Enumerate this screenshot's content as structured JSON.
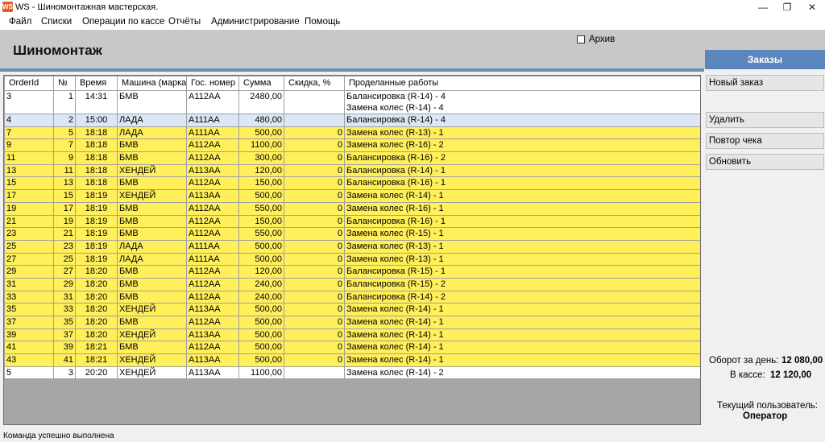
{
  "window": {
    "title": "WS - Шиномонтажная мастерская.",
    "app_icon": "WS",
    "minimize_glyph": "—",
    "restore_glyph": "❐",
    "close_glyph": "✕"
  },
  "menu": [
    "Файл",
    "Списки",
    "Операции по кассе",
    "Отчёты",
    "Администрирование",
    "Помощь"
  ],
  "page": {
    "title": "Шиномонтаж",
    "archive_label": "Архив"
  },
  "sidebar": {
    "tab": "Заказы",
    "new_order": "Новый заказ",
    "delete": "Удалить",
    "repeat_receipt": "Повтор чека",
    "refresh": "Обновить"
  },
  "table": {
    "columns": [
      "OrderId",
      "№",
      "Время",
      "Машина (марка)",
      "Гос. номер",
      "Сумма",
      "Скидка, %",
      "Проделанные работы"
    ],
    "rows": [
      {
        "style": "white",
        "cells": [
          "3",
          "1",
          "14:31",
          "БМВ",
          "А112АА",
          "2480,00",
          "",
          "Балансировка (R-14) - 4",
          "Замена колес (R-14) - 4"
        ]
      },
      {
        "style": "sel",
        "cells": [
          "4",
          "2",
          "15:00",
          "ЛАДА",
          "А111АА",
          "480,00",
          "",
          "Балансировка (R-14) - 4"
        ]
      },
      {
        "style": "yellow",
        "cells": [
          "7",
          "5",
          "18:18",
          "ЛАДА",
          "А111АА",
          "500,00",
          "0",
          "Замена колес (R-13) - 1"
        ]
      },
      {
        "style": "yellow",
        "cells": [
          "9",
          "7",
          "18:18",
          "БМВ",
          "А112АА",
          "1100,00",
          "0",
          "Замена колес (R-16) - 2"
        ]
      },
      {
        "style": "yellow",
        "cells": [
          "11",
          "9",
          "18:18",
          "БМВ",
          "А112АА",
          "300,00",
          "0",
          "Балансировка (R-16) - 2"
        ]
      },
      {
        "style": "yellow",
        "cells": [
          "13",
          "11",
          "18:18",
          "ХЕНДЕЙ",
          "А113АА",
          "120,00",
          "0",
          "Балансировка (R-14) - 1"
        ]
      },
      {
        "style": "yellow",
        "cells": [
          "15",
          "13",
          "18:18",
          "БМВ",
          "А112АА",
          "150,00",
          "0",
          "Балансировка (R-16) - 1"
        ]
      },
      {
        "style": "yellow",
        "cells": [
          "17",
          "15",
          "18:19",
          "ХЕНДЕЙ",
          "А113АА",
          "500,00",
          "0",
          "Замена колес (R-14) - 1"
        ]
      },
      {
        "style": "yellow",
        "cells": [
          "19",
          "17",
          "18:19",
          "БМВ",
          "А112АА",
          "550,00",
          "0",
          "Замена колес (R-16) - 1"
        ]
      },
      {
        "style": "yellow",
        "cells": [
          "21",
          "19",
          "18:19",
          "БМВ",
          "А112АА",
          "150,00",
          "0",
          "Балансировка (R-16) - 1"
        ]
      },
      {
        "style": "yellow",
        "cells": [
          "23",
          "21",
          "18:19",
          "БМВ",
          "А112АА",
          "550,00",
          "0",
          "Замена колес (R-15) - 1"
        ]
      },
      {
        "style": "yellow",
        "cells": [
          "25",
          "23",
          "18:19",
          "ЛАДА",
          "А111АА",
          "500,00",
          "0",
          "Замена колес (R-13) - 1"
        ]
      },
      {
        "style": "yellow",
        "cells": [
          "27",
          "25",
          "18:19",
          "ЛАДА",
          "А111АА",
          "500,00",
          "0",
          "Замена колес (R-13) - 1"
        ]
      },
      {
        "style": "yellow",
        "cells": [
          "29",
          "27",
          "18:20",
          "БМВ",
          "А112АА",
          "120,00",
          "0",
          "Балансировка (R-15) - 1"
        ]
      },
      {
        "style": "yellow",
        "cells": [
          "31",
          "29",
          "18:20",
          "БМВ",
          "А112АА",
          "240,00",
          "0",
          "Балансировка (R-15) - 2"
        ]
      },
      {
        "style": "yellow",
        "cells": [
          "33",
          "31",
          "18:20",
          "БМВ",
          "А112АА",
          "240,00",
          "0",
          "Балансировка (R-14) - 2"
        ]
      },
      {
        "style": "yellow",
        "cells": [
          "35",
          "33",
          "18:20",
          "ХЕНДЕЙ",
          "А113АА",
          "500,00",
          "0",
          "Замена колес (R-14) - 1"
        ]
      },
      {
        "style": "yellow",
        "cells": [
          "37",
          "35",
          "18:20",
          "БМВ",
          "А112АА",
          "500,00",
          "0",
          "Замена колес (R-14) - 1"
        ]
      },
      {
        "style": "yellow",
        "cells": [
          "39",
          "37",
          "18:20",
          "ХЕНДЕЙ",
          "А113АА",
          "500,00",
          "0",
          "Замена колес (R-14) - 1"
        ]
      },
      {
        "style": "yellow",
        "cells": [
          "41",
          "39",
          "18:21",
          "БМВ",
          "А112АА",
          "500,00",
          "0",
          "Замена колес (R-14) - 1"
        ]
      },
      {
        "style": "yellow",
        "cells": [
          "43",
          "41",
          "18:21",
          "ХЕНДЕЙ",
          "А113АА",
          "500,00",
          "0",
          "Замена колес (R-14) - 1"
        ]
      },
      {
        "style": "white",
        "cells": [
          "5",
          "3",
          "20:20",
          "ХЕНДЕЙ",
          "А113АА",
          "1100,00",
          "",
          "Замена колес (R-14) - 2"
        ]
      }
    ]
  },
  "stats": {
    "turnover_label": "Оборот за день:",
    "turnover_value": "12 080,00",
    "cash_label": "В кассе:",
    "cash_value": "12 120,00",
    "user_label": "Текущий пользователь:",
    "user_value": "Оператор"
  },
  "status": "Команда успешно выполнена",
  "colors": {
    "accent": "#5b85bd",
    "row_highlight": "#ffef5a",
    "row_selected": "#dce6f4"
  }
}
